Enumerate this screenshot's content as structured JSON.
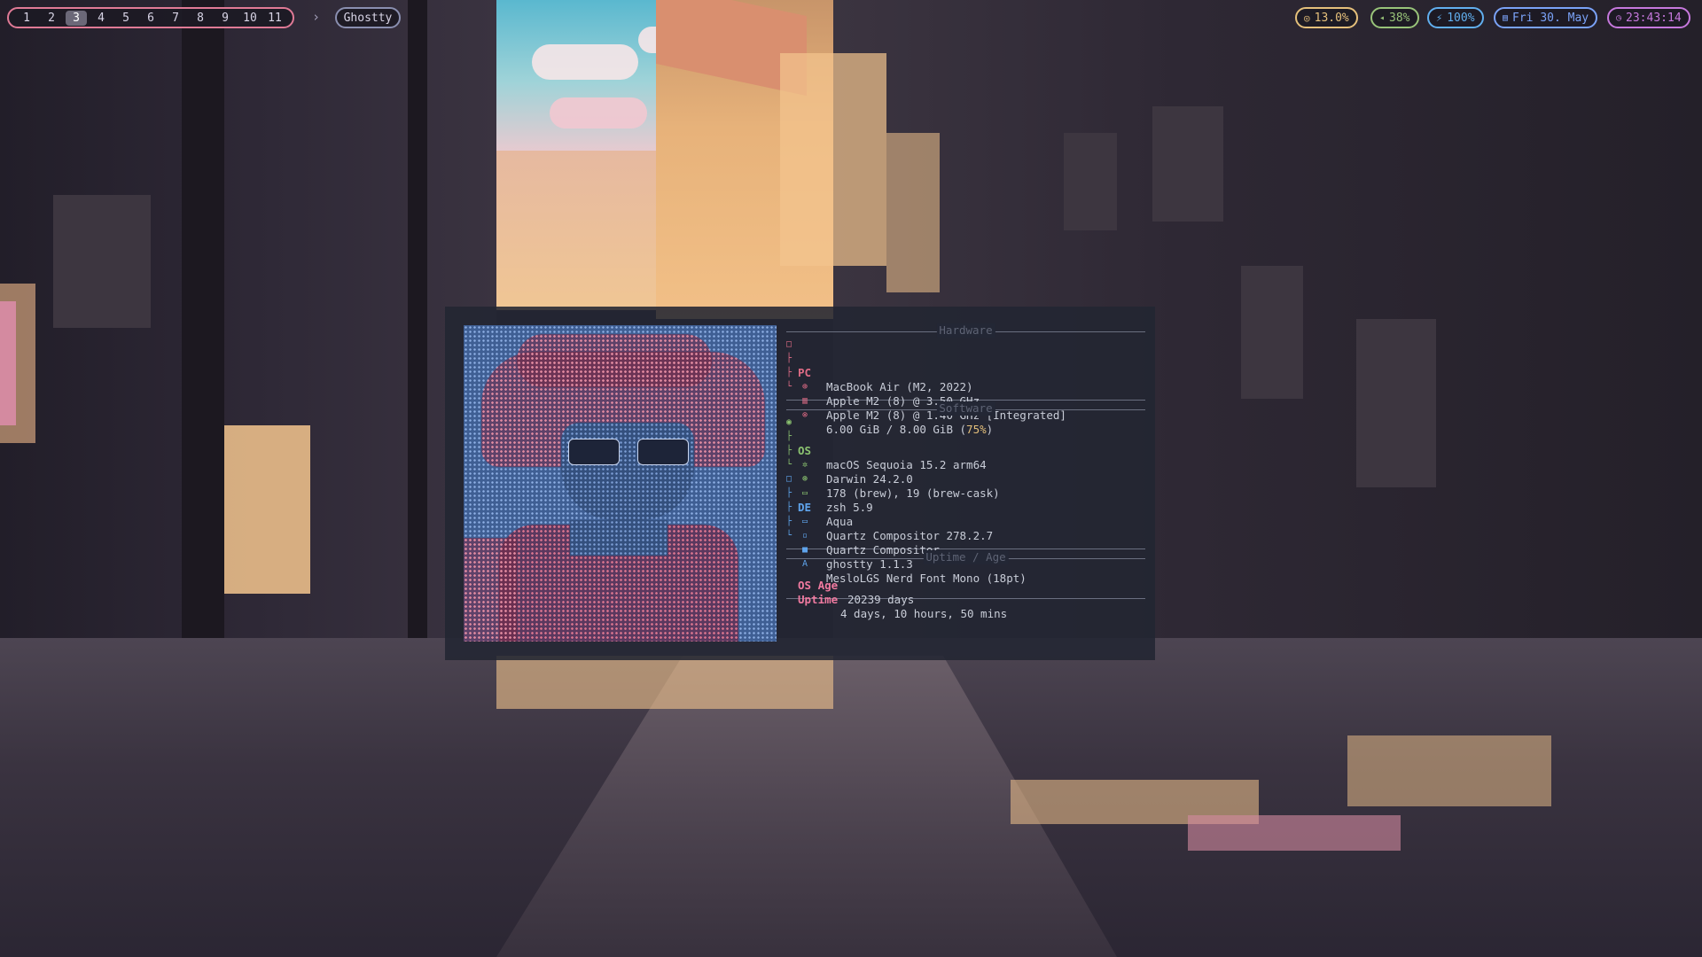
{
  "topbar": {
    "workspaces": [
      "1",
      "2",
      "3",
      "4",
      "5",
      "6",
      "7",
      "8",
      "9",
      "10",
      "11"
    ],
    "active_workspace": "3",
    "arrow": "›",
    "active_app": "Ghostty",
    "cpu": "13.0%",
    "volume": "38%",
    "battery": "100%",
    "date": "Fri 30. May",
    "time": "23:43:14",
    "icons": {
      "cpu": "cpu-icon",
      "volume": "speaker-icon",
      "battery": "bolt-icon",
      "date": "calendar-icon",
      "time": "clock-icon"
    }
  },
  "terminal": {
    "sections": {
      "hardware": "Hardware",
      "software": "Software",
      "uptime": "Uptime / Age"
    },
    "hardware": {
      "key": "PC",
      "model": "MacBook Air (M2, 2022)",
      "cpu": "Apple M2 (8) @ 3.50 GHz",
      "gpu": "Apple M2 (8) @ 1.40 GHz [Integrated]",
      "memory": "6.00 GiB / 8.00 GiB (",
      "memory_pct": "75%",
      "memory_close": ")"
    },
    "software": {
      "os_key": "OS",
      "os": "macOS Sequoia 15.2 arm64",
      "kernel": "Darwin 24.2.0",
      "packages": "178 (brew), 19 (brew-cask)",
      "shell": "zsh 5.9",
      "de_key": "DE",
      "de": "Aqua",
      "wm": "Quartz Compositor 278.2.7",
      "wm_theme": "Quartz Compositor",
      "terminal": "ghostty 1.1.3",
      "font": "MesloLGS Nerd Font Mono (18pt)"
    },
    "uptime": {
      "os_age_key": "OS Age",
      "os_age": "20239 days",
      "uptime_key": "Uptime",
      "uptime": "4 days, 10 hours, 50 mins"
    }
  },
  "colors": {
    "workspace_border": "#e07a96",
    "cpu": "#e5c07b",
    "volume": "#98c379",
    "battery": "#61afef",
    "date": "#7aa2f7",
    "clock": "#c678dd"
  }
}
